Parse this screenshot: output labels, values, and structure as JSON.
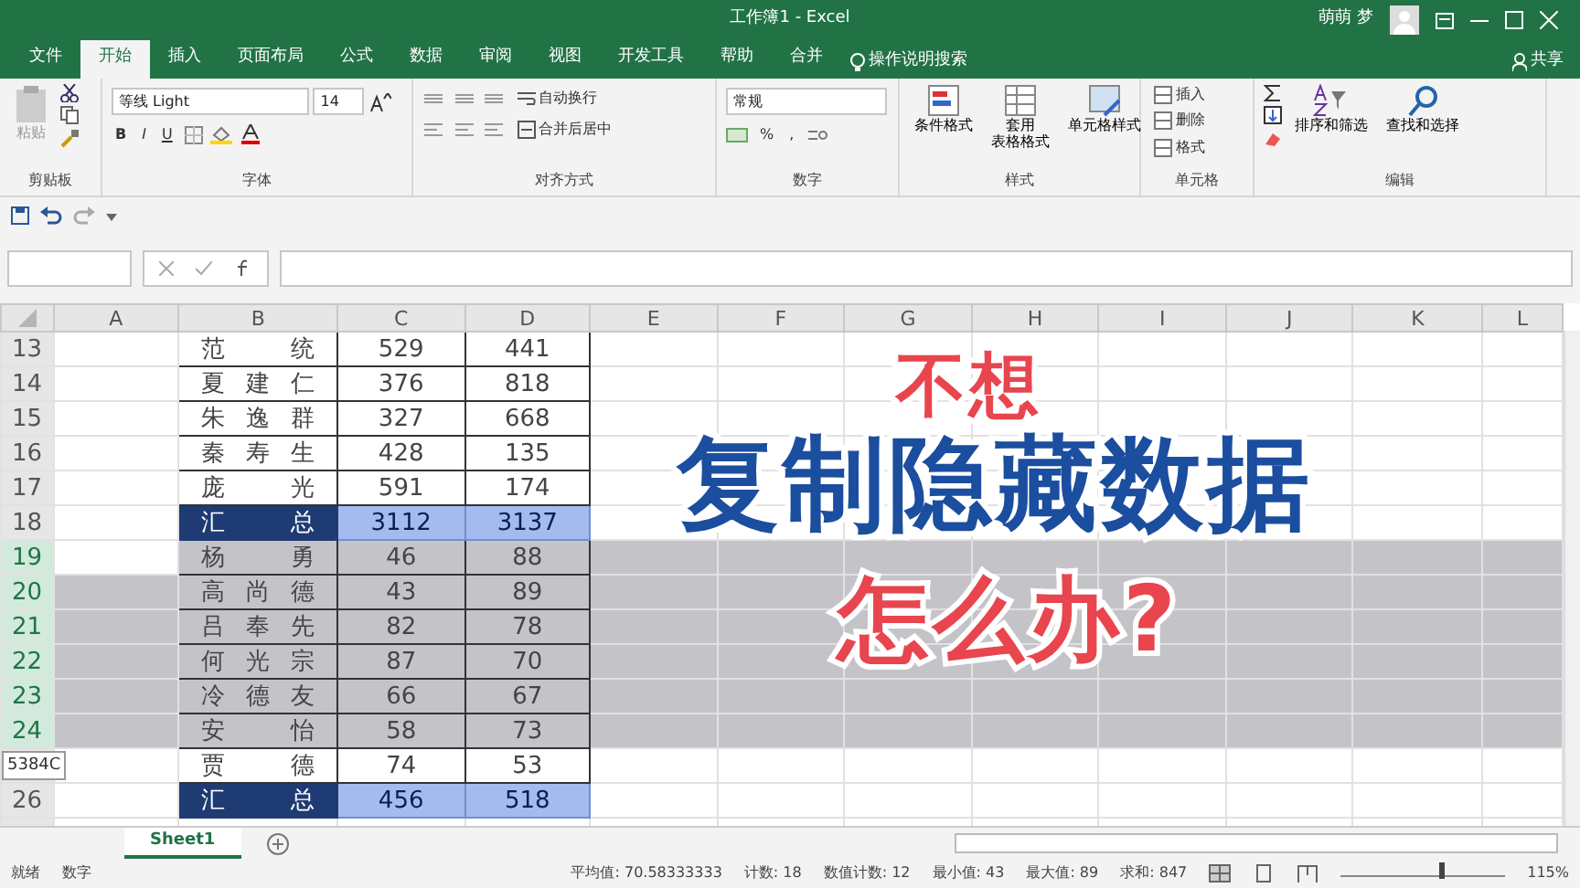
{
  "window": {
    "title": "工作簿1 - Excel",
    "user": "萌萌 梦"
  },
  "ribbon_tabs": [
    {
      "label": "文件",
      "selected": false
    },
    {
      "label": "开始",
      "selected": true
    },
    {
      "label": "插入",
      "selected": false
    },
    {
      "label": "页面布局",
      "selected": false
    },
    {
      "label": "公式",
      "selected": false
    },
    {
      "label": "数据",
      "selected": false
    },
    {
      "label": "审阅",
      "selected": false
    },
    {
      "label": "视图",
      "selected": false
    },
    {
      "label": "开发工具",
      "selected": false
    },
    {
      "label": "帮助",
      "selected": false
    },
    {
      "label": "合并",
      "selected": false
    }
  ],
  "tell_me": "操作说明搜索",
  "share": "共享",
  "ribbon": {
    "clipboard": {
      "paste": "粘贴",
      "label": "剪贴板"
    },
    "font": {
      "name": "等线 Light",
      "size": "14",
      "bold": "B",
      "italic": "I",
      "underline": "U",
      "label": "字体"
    },
    "alignment": {
      "wrap": "自动换行",
      "merge": "合并后居中",
      "label": "对齐方式"
    },
    "number": {
      "format": "常规",
      "percent": "%",
      "comma": ",",
      "label": "数字"
    },
    "styles": {
      "buttons": [
        {
          "lines": [
            "条件格式"
          ]
        },
        {
          "lines": [
            "套用",
            "表格格式"
          ]
        },
        {
          "lines": [
            "单元格样式"
          ]
        }
      ],
      "label": "样式"
    },
    "cells": {
      "buttons": [
        "插入",
        "删除",
        "格式"
      ],
      "label": "单元格"
    },
    "editing": {
      "buttons": [
        "排序和筛选",
        "查找和选择"
      ],
      "label": "编辑"
    }
  },
  "columns": [
    "A",
    "B",
    "C",
    "D",
    "E",
    "F",
    "G",
    "H",
    "I",
    "J",
    "K",
    "L"
  ],
  "rows": [
    {
      "header": "13",
      "name": "范统",
      "c": "529",
      "d": "441",
      "kind": "normal",
      "selected": false
    },
    {
      "header": "14",
      "name": "夏建仁",
      "c": "376",
      "d": "818",
      "kind": "normal",
      "selected": false
    },
    {
      "header": "15",
      "name": "朱逸群",
      "c": "327",
      "d": "668",
      "kind": "normal",
      "selected": false
    },
    {
      "header": "16",
      "name": "秦寿生",
      "c": "428",
      "d": "135",
      "kind": "normal",
      "selected": false
    },
    {
      "header": "17",
      "name": "庞光",
      "c": "591",
      "d": "174",
      "kind": "normal",
      "selected": false
    },
    {
      "header": "18",
      "name": "汇总",
      "c": "3112",
      "d": "3137",
      "kind": "total",
      "selected": false
    },
    {
      "header": "19",
      "name": "杨勇",
      "c": "46",
      "d": "88",
      "kind": "normal",
      "selected": true
    },
    {
      "header": "20",
      "name": "高尚德",
      "c": "43",
      "d": "89",
      "kind": "normal",
      "selected": true
    },
    {
      "header": "21",
      "name": "吕奉先",
      "c": "82",
      "d": "78",
      "kind": "normal",
      "selected": true
    },
    {
      "header": "22",
      "name": "何光宗",
      "c": "87",
      "d": "70",
      "kind": "normal",
      "selected": true
    },
    {
      "header": "23",
      "name": "冷德友",
      "c": "66",
      "d": "67",
      "kind": "normal",
      "selected": true
    },
    {
      "header": "24",
      "name": "安怡",
      "c": "58",
      "d": "73",
      "kind": "normal",
      "selected": true
    },
    {
      "tooltip": "5384C",
      "name": "贾德",
      "c": "74",
      "d": "53",
      "kind": "normal",
      "selected": false
    },
    {
      "header": "26",
      "name": "汇总",
      "c": "456",
      "d": "518",
      "kind": "total",
      "selected": false
    }
  ],
  "sheet_tabs": [
    {
      "label": "Sheet1",
      "selected": true
    }
  ],
  "status_bar": {
    "mode": "就绪",
    "num": "数字",
    "stats": [
      "平均值: 70.58333333",
      "计数: 18",
      "数值计数: 12",
      "最小值: 43",
      "最大值: 89",
      "求和: 847"
    ],
    "zoom": "115%",
    "zoom_slider": {
      "level": 0.62
    }
  },
  "overlay": [
    {
      "text": "不想",
      "kind": "red"
    },
    {
      "text": "复制隐藏数据",
      "kind": "blue"
    },
    {
      "text": "怎么办?",
      "kind": "red"
    }
  ]
}
